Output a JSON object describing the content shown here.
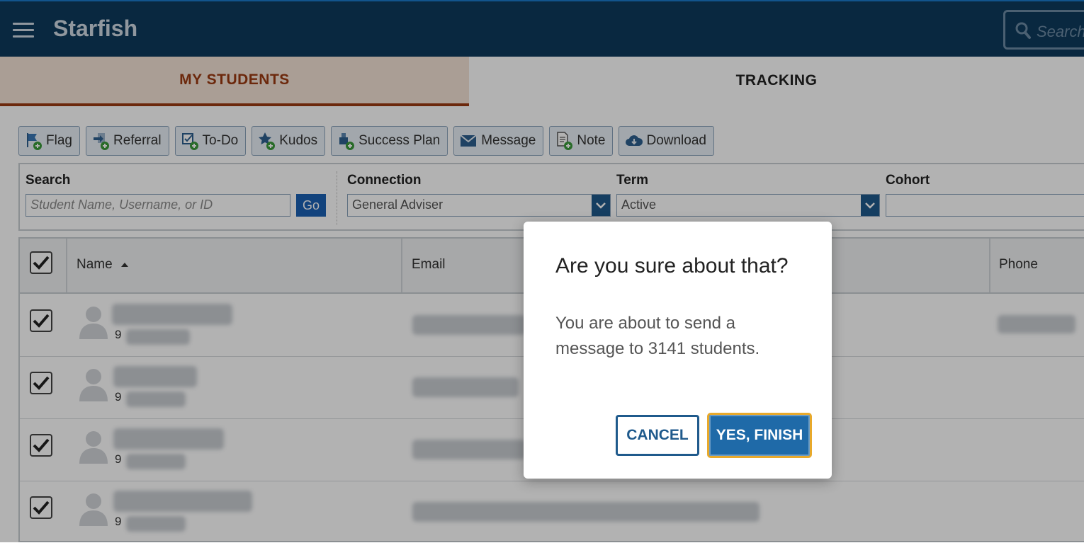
{
  "app": {
    "title": "Starfish"
  },
  "header": {
    "search_placeholder": "Search"
  },
  "tabs": [
    {
      "label": "MY STUDENTS",
      "active": true
    },
    {
      "label": "TRACKING",
      "active": false
    }
  ],
  "toolbar": [
    {
      "label": "Flag",
      "icon": "flag-add-icon"
    },
    {
      "label": "Referral",
      "icon": "referral-add-icon"
    },
    {
      "label": "To-Do",
      "icon": "todo-add-icon"
    },
    {
      "label": "Kudos",
      "icon": "kudos-add-icon"
    },
    {
      "label": "Success Plan",
      "icon": "success-plan-add-icon"
    },
    {
      "label": "Message",
      "icon": "envelope-icon"
    },
    {
      "label": "Note",
      "icon": "note-add-icon"
    },
    {
      "label": "Download",
      "icon": "cloud-download-icon"
    }
  ],
  "filters": {
    "search": {
      "label": "Search",
      "placeholder": "Student Name, Username, or ID",
      "go": "Go"
    },
    "connection": {
      "label": "Connection",
      "value": "General Adviser"
    },
    "term": {
      "label": "Term",
      "value": "Active"
    },
    "cohort": {
      "label": "Cohort",
      "value": ""
    }
  },
  "table": {
    "columns": [
      "Name",
      "Email",
      "Phone"
    ],
    "rows": [
      {
        "id_prefix": "9"
      },
      {
        "id_prefix": "9"
      },
      {
        "id_prefix": "9"
      },
      {
        "id_prefix": "9"
      }
    ]
  },
  "dialog": {
    "title": "Are you sure about that?",
    "body": "You are about to send a message to 3141 students.",
    "cancel": "CANCEL",
    "confirm": "YES, FINISH"
  },
  "colors": {
    "header_bg": "#0e3a5c",
    "tab_accent": "#9b3a12",
    "primary": "#1f6aa8",
    "focus_ring": "#e8a92b"
  }
}
